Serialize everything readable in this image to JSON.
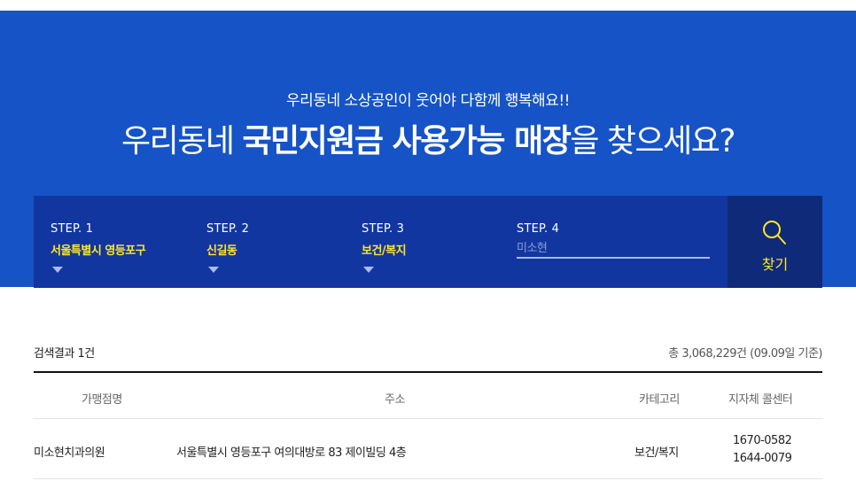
{
  "hero": {
    "subtitle": "우리동네 소상공인이 웃어야 다함께 행복해요!!",
    "title_part1": "우리동네 ",
    "title_bold1": "국민지원금 사용가능 매장",
    "title_part2": "을 찾으세요?"
  },
  "steps": [
    {
      "label": "STEP. 1",
      "value": "서울특별시 영등포구"
    },
    {
      "label": "STEP. 2",
      "value": "신길동"
    },
    {
      "label": "STEP. 3",
      "value": "보건/복지"
    },
    {
      "label": "STEP. 4",
      "value": "",
      "placeholder": "미소현"
    }
  ],
  "search": {
    "label": "찾기",
    "icon": "search-icon"
  },
  "results": {
    "count_label": "검색결과 1건",
    "total_label": "총 3,068,229건 (09.09일 기준)"
  },
  "table": {
    "headers": [
      "가맹점명",
      "주소",
      "카테고리",
      "지자체 콜센터"
    ],
    "rows": [
      {
        "name": "미소현치과의원",
        "address": "서울특별시 영등포구 여의대방로 83 제이빌딩 4층",
        "category": "보건/복지",
        "phone1": "1670-0582",
        "phone2": "1644-0079"
      }
    ]
  },
  "colors": {
    "hero_bg": "#1653c6",
    "stepbar_bg": "#1236a0",
    "search_bg": "#0f2a78",
    "accent_yellow": "#ffe629"
  }
}
